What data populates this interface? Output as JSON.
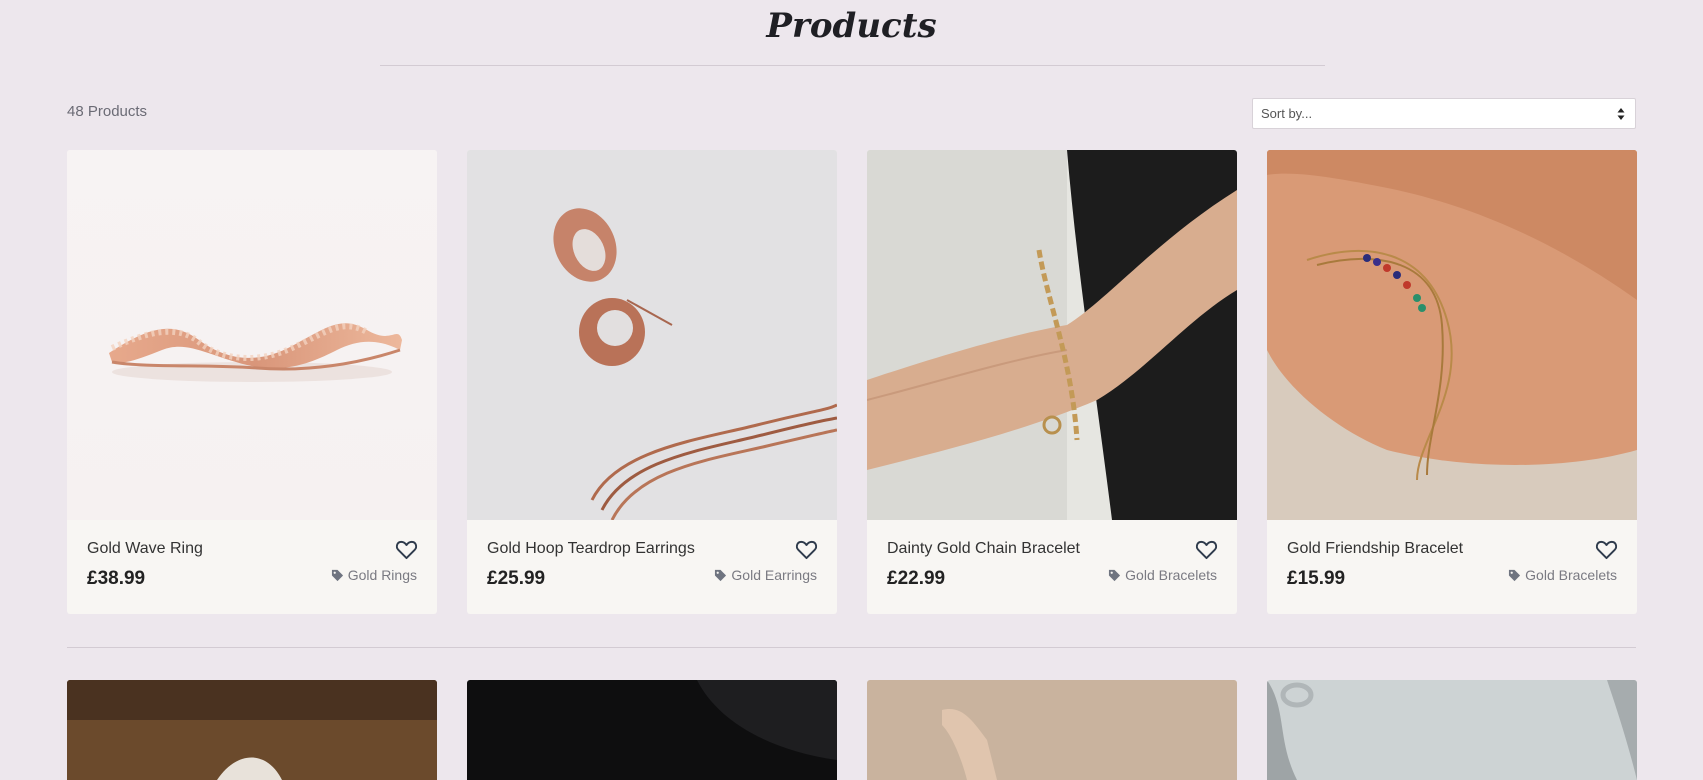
{
  "page": {
    "title": "Products",
    "count": "48 Products"
  },
  "sort": {
    "label": "Sort by..."
  },
  "products": [
    {
      "name": "Gold Wave Ring",
      "price": "£38.99",
      "category": "Gold Rings"
    },
    {
      "name": "Gold Hoop Teardrop Earrings",
      "price": "£25.99",
      "category": "Gold Earrings"
    },
    {
      "name": "Dainty Gold Chain Bracelet",
      "price": "£22.99",
      "category": "Gold Bracelets"
    },
    {
      "name": "Gold Friendship Bracelet",
      "price": "£15.99",
      "category": "Gold Bracelets"
    }
  ],
  "icons": {
    "heart": "heart-outline-icon",
    "tag": "tag-icon",
    "sort_arrows": "sort-arrows-icon"
  },
  "colors": {
    "background": "#ede7ed",
    "card": "#f8f6f3",
    "heart": "#2f3b4c"
  }
}
